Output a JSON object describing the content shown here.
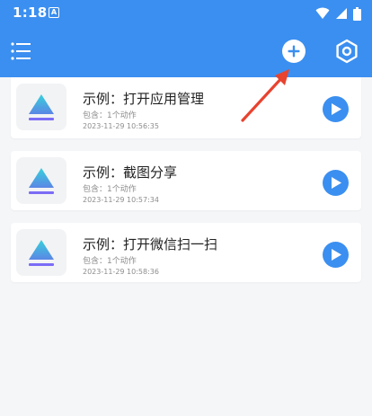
{
  "status_bar": {
    "time": "1:18",
    "app_badge": "A"
  },
  "toolbar": {
    "menu_icon": "menu-icon",
    "add_icon": "add-circle-icon",
    "settings_icon": "settings-hexagon-icon"
  },
  "colors": {
    "primary": "#3b8ff0",
    "annotation_arrow": "#e8432f",
    "triangle_gradient_top": "#36d1dc",
    "triangle_gradient_bottom": "#5b86e5",
    "bar_color": "#7b6cf6"
  },
  "tasks": [
    {
      "title": "示例：打开应用管理",
      "actions": "包含：1个动作",
      "timestamp": "2023-11-29 10:56:35"
    },
    {
      "title": "示例：截图分享",
      "actions": "包含：1个动作",
      "timestamp": "2023-11-29 10:57:34"
    },
    {
      "title": "示例：打开微信扫一扫",
      "actions": "包含：1个动作",
      "timestamp": "2023-11-29 10:58:36"
    }
  ]
}
